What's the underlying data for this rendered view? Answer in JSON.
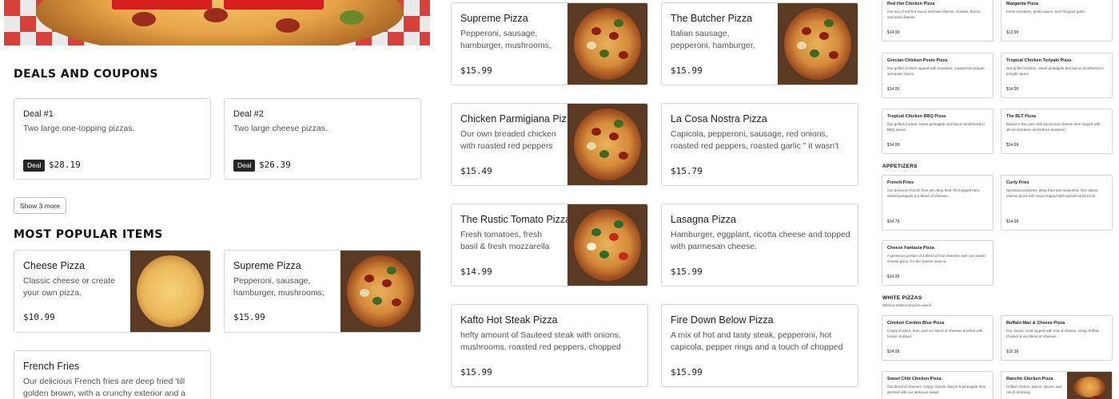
{
  "left": {
    "deals_title": "Deals and coupons",
    "deals": [
      {
        "name": "Deal #1",
        "desc": "Two large one-topping pizzas.",
        "tag": "Deal",
        "price": "$28.19"
      },
      {
        "name": "Deal #2",
        "desc": "Two large cheese pizzas.",
        "tag": "Deal",
        "price": "$26.39"
      }
    ],
    "show_more": "Show 3 more",
    "popular_title": "Most popular items",
    "popular": [
      {
        "name": "Cheese Pizza",
        "desc": "Classic cheese or create your own pizza.",
        "price": "$10.99"
      },
      {
        "name": "Supreme Pizza",
        "desc": "Pepperoni, sausage, hamburger, mushrooms,",
        "price": "$15.99"
      },
      {
        "name": "French Fries",
        "desc": "Our delicious French fries are deep fried 'till golden brown, with a crunchy exterior and a light"
      }
    ]
  },
  "middle": {
    "items": [
      {
        "name": "Supreme Pizza",
        "desc": "Pepperoni, sausage, hamburger, mushrooms,",
        "price": "$15.99",
        "img": true
      },
      {
        "name": "The Butcher Pizza",
        "desc": "Italian sausage, pepperoni, hamburger, crispy bacon,",
        "price": "$15.99",
        "img": true
      },
      {
        "name": "Chicken Parmigiana Pizza",
        "desc": "Our own breaded chicken with roasted red peppers",
        "price": "$15.49",
        "img": true
      },
      {
        "name": "La Cosa Nostra Pizza",
        "desc": "Capicola, pepperoni, sausage, red onions, roasted red peppers, roasted garlic \" it wasn't me \".",
        "price": "$15.79",
        "img": false
      },
      {
        "name": "The Rustic Tomato Pizza",
        "desc": "Fresh tomatoes, fresh basil & fresh mozzarella cheese.",
        "price": "$14.99",
        "img": true
      },
      {
        "name": "Lasagna Pizza",
        "desc": "Hamburger, eggplant, ricotta cheese and topped with parmesan cheese.",
        "price": "$15.99",
        "img": false
      },
      {
        "name": "Kafto Hot Steak Pizza",
        "desc": "hefty amount of Sauteed steak with onions, mushrooms, roasted red peppers, chopped garlic",
        "price": "$15.99",
        "img": false
      },
      {
        "name": "Fire Down Below Pizza",
        "desc": "A mix of hot and tasty steak, pepperoni, hot capicola, pepper rings and a touch of chopped",
        "price": "$15.99",
        "img": false
      }
    ]
  },
  "right": {
    "cards": [
      {
        "name": "Red Hot Chicken Pizza",
        "desc": "Our mix of red hot sauce and blue cheese, chicken, bacon, and extra cheese.",
        "price": "$14.99"
      },
      {
        "name": "Margarita Pizza",
        "desc": "Fresh tomatoes, pesto sauce, and chopped garlic.",
        "price": "$13.99"
      },
      {
        "name": "Grecian Chicken Pesto Pizza",
        "desc": "Our grilled chicken topped with tomatoes, roasted red pepper, and pesto sauce.",
        "price": "$14.99"
      },
      {
        "name": "Tropical Chicken Teriyaki Pizza",
        "desc": "Our grilled chicken, sweet pineapple and bacon smothered in teriyaki sauce.",
        "price": "$14.99"
      },
      {
        "name": "Tropical Chicken BBQ Pizza",
        "desc": "Our grilled chicken, sweet pineapple and bacon smothered in BBQ sauce.",
        "price": "$14.99"
      },
      {
        "name": "The BLT Pizza",
        "desc": "Baked in the oven with bacon and cheese then topped with sliced tomatoes and lettuce tossed in",
        "price": "$14.99"
      },
      {
        "name": "French Fries",
        "desc": "Our delicious French fries are deep fried 'till chopped ham, sweet pineapple & a blend of cheeses.",
        "price": "$14.79"
      },
      {
        "name": "Curly Fries",
        "desc": "Spiralized potatoes, deep fried and seasoned. Our classic cheese pizza with sauce topped with spinach & broccoli.",
        "price": "$14.99"
      },
      {
        "name": "Cheese Fantasia Pizza",
        "desc": "A generous portion of a blend of four cheeses over our classic cheese pizza- for the cheese lover in",
        "price": "$14.99"
      },
      {
        "name": "Chicken Cordon Blue Pizza",
        "desc": "Crispy chicken, ham, and our blend of cheeses drizzled with honey mustard.",
        "price": "$14.99"
      },
      {
        "name": "Buffalo Mac & Cheese Pizza",
        "desc": "Our classic crust topped with mac & cheese, crispy buffalo chicken & our blend of cheeses.",
        "price": "$15.39"
      },
      {
        "name": "Sweet Chili Chicken Pizza",
        "desc": "Our blend of cheeses, crispy chicken, bacon & pineapple then drizzled with our delicious sweet",
        "price": ""
      },
      {
        "name": "Rancho Chicken Pizza",
        "desc": "Grilled chicken, bacon, spices, and ranch dressing.",
        "price": ""
      }
    ],
    "appetizers_title": "Appetizers",
    "white_title": "White pizzas",
    "white_sub": "Without traditional pizza sauce."
  }
}
